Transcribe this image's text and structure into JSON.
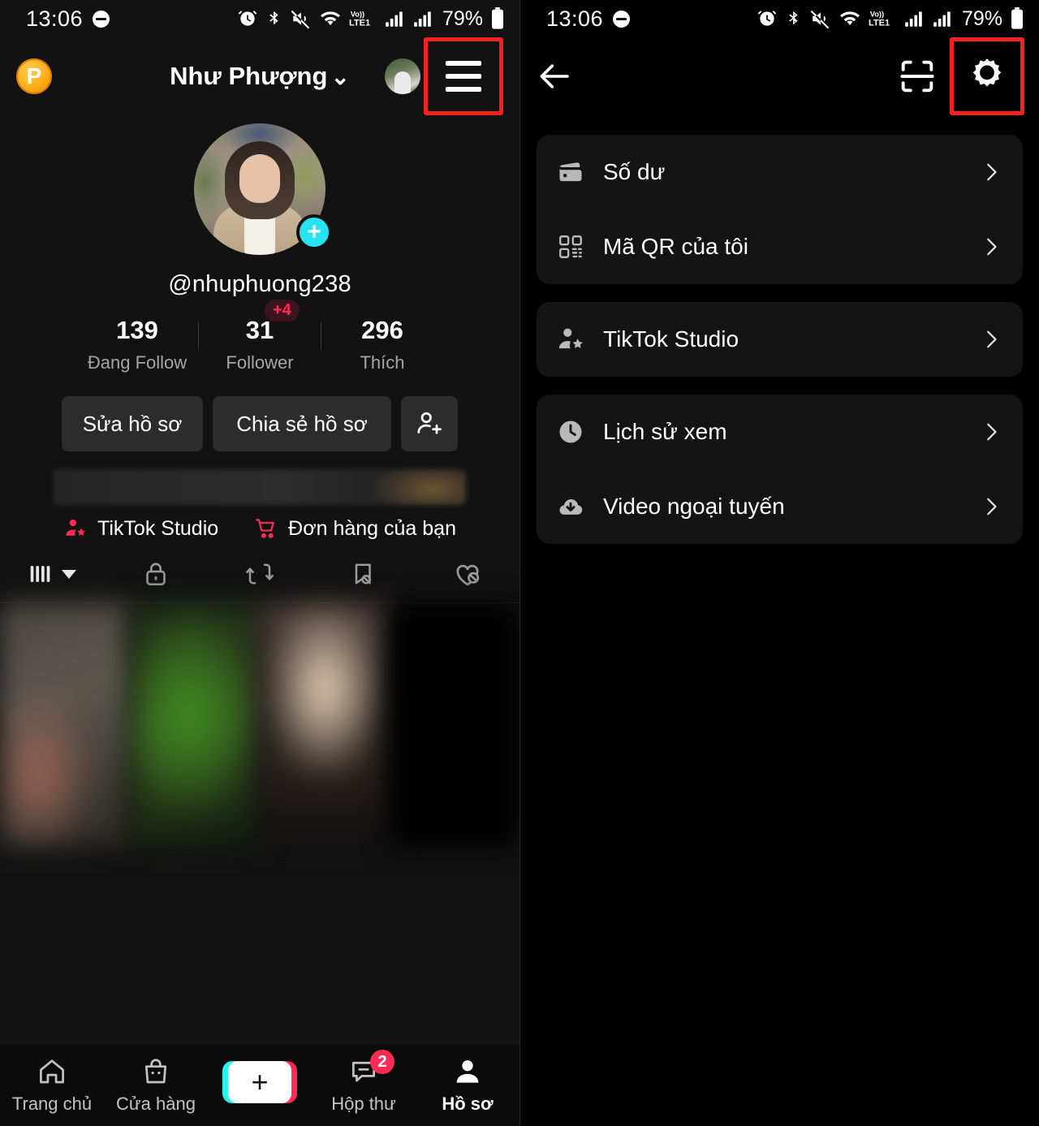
{
  "status_bar": {
    "time": "13:06",
    "battery_percent": "79%",
    "network_label": "LTE1",
    "volte_label": "Vo))",
    "icons": [
      "alarm-icon",
      "bluetooth-icon",
      "mute-vibrate-icon",
      "wifi-icon",
      "volte-icon",
      "signal-sim1-icon",
      "signal-sim2-icon",
      "battery-icon"
    ]
  },
  "left_panel": {
    "app_bar": {
      "coin_badge_letter": "P",
      "title": "Như Phượng",
      "chevron": "⌄",
      "avatar_name": "mini-avatar",
      "menu_icon_name": "hamburger-menu-icon",
      "highlighted": true
    },
    "profile": {
      "handle": "@nhuphuong238",
      "add_friend_plus": "+",
      "stats": [
        {
          "value": "139",
          "label": "Đang Follow",
          "badge": ""
        },
        {
          "value": "31",
          "label": "Follower",
          "badge": "+4"
        },
        {
          "value": "296",
          "label": "Thích",
          "badge": ""
        }
      ],
      "buttons": {
        "edit": "Sửa hồ sơ",
        "share": "Chia sẻ hồ sơ",
        "add_user_icon": "add-user-icon"
      },
      "shortcuts": [
        {
          "label": "TikTok Studio",
          "icon": "creator-star-icon"
        },
        {
          "label": "Đơn hàng của bạn",
          "icon": "shopping-cart-icon"
        }
      ],
      "tabs": [
        {
          "icon": "posts-grid-icon",
          "name": "tab-posts"
        },
        {
          "icon": "lock-icon",
          "name": "tab-private"
        },
        {
          "icon": "repost-icon",
          "name": "tab-repost"
        },
        {
          "icon": "bookmark-off-icon",
          "name": "tab-saved"
        },
        {
          "icon": "heart-off-icon",
          "name": "tab-liked"
        }
      ]
    },
    "bottom_nav": [
      {
        "label": "Trang chủ",
        "icon": "home-icon",
        "active": false,
        "badge": ""
      },
      {
        "label": "Cửa hàng",
        "icon": "shop-bag-icon",
        "active": false,
        "badge": ""
      },
      {
        "label": "",
        "icon": "create-plus-icon",
        "active": false,
        "badge": ""
      },
      {
        "label": "Hộp thư",
        "icon": "inbox-icon",
        "active": false,
        "badge": "2"
      },
      {
        "label": "Hồ sơ",
        "icon": "profile-person-icon",
        "active": true,
        "badge": ""
      }
    ]
  },
  "right_panel": {
    "app_bar": {
      "back_icon": "back-arrow-icon",
      "scan_icon": "scan-qr-icon",
      "settings_icon": "gear-settings-icon",
      "highlighted": true
    },
    "menu_groups": [
      {
        "items": [
          {
            "label": "Số dư",
            "icon": "wallet-icon"
          },
          {
            "label": "Mã QR của tôi",
            "icon": "qr-code-icon"
          }
        ]
      },
      {
        "items": [
          {
            "label": "TikTok Studio",
            "icon": "creator-star-icon"
          }
        ]
      },
      {
        "items": [
          {
            "label": "Lịch sử xem",
            "icon": "clock-history-icon"
          },
          {
            "label": "Video ngoại tuyến",
            "icon": "cloud-download-icon"
          }
        ]
      }
    ]
  },
  "colors": {
    "accent_pink": "#fe2c55",
    "accent_cyan": "#25e4ef",
    "highlight_red": "#f2231c",
    "coin_gold": "#ffb01f",
    "card_bg": "#141414",
    "button_bg": "#2c2c2c"
  }
}
